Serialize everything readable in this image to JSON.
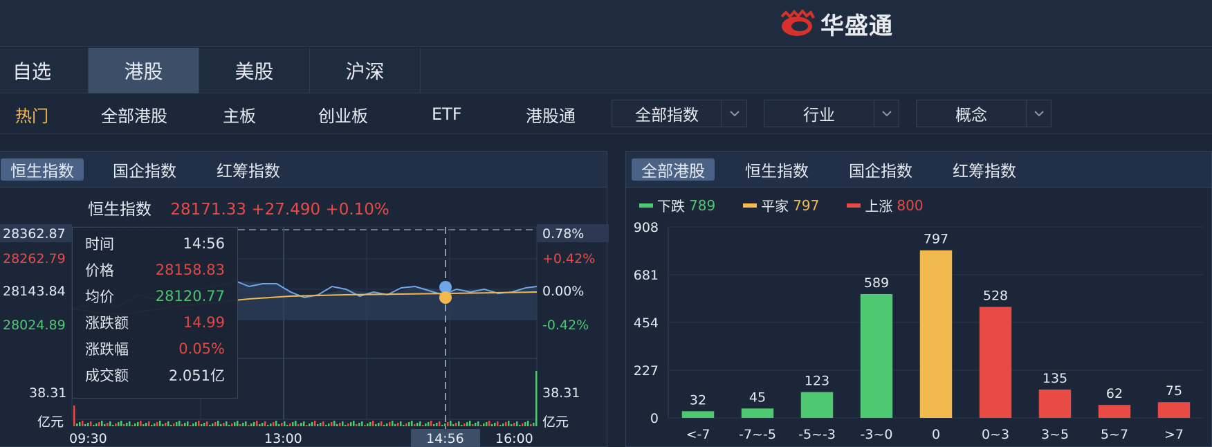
{
  "brand": {
    "name": "华盛通"
  },
  "market_tabs": [
    {
      "label": "自选"
    },
    {
      "label": "港股"
    },
    {
      "label": "美股"
    },
    {
      "label": "沪深"
    }
  ],
  "sub_nav": {
    "items": [
      {
        "label": "热门"
      },
      {
        "label": "全部港股"
      },
      {
        "label": "主板"
      },
      {
        "label": "创业板"
      },
      {
        "label": "ETF"
      },
      {
        "label": "港股通"
      }
    ],
    "dropdowns": [
      {
        "label": "全部指数"
      },
      {
        "label": "行业"
      },
      {
        "label": "概念"
      }
    ]
  },
  "left_panel": {
    "tabs": [
      {
        "label": "恒生指数"
      },
      {
        "label": "国企指数"
      },
      {
        "label": "红筹指数"
      }
    ],
    "quote": {
      "name": "恒生指数",
      "price": "28171.33",
      "change": "+27.490",
      "change_pct": "+0.10%"
    },
    "price_axis_left": [
      "28362.87",
      "28262.79",
      "28143.84",
      "28024.89"
    ],
    "price_axis_right": [
      "0.78%",
      "+0.42%",
      "0.00%",
      "-0.42%"
    ],
    "volume_axis": {
      "value": "38.31",
      "unit": "亿元"
    },
    "time_axis": [
      "09:30",
      "13:00",
      "16:00"
    ],
    "cursor_time": "14:56",
    "tooltip": {
      "rows": [
        {
          "key": "时间",
          "value": "14:56"
        },
        {
          "key": "价格",
          "value": "28158.83"
        },
        {
          "key": "均价",
          "value": "28120.77"
        },
        {
          "key": "涨跌额",
          "value": "14.99"
        },
        {
          "key": "涨跌幅",
          "value": "0.05%"
        },
        {
          "key": "成交额",
          "value": "2.051亿"
        }
      ]
    }
  },
  "right_panel": {
    "tabs": [
      {
        "label": "全部港股"
      },
      {
        "label": "恒生指数"
      },
      {
        "label": "国企指数"
      },
      {
        "label": "红筹指数"
      }
    ],
    "legend": [
      {
        "label": "下跌",
        "value": "789",
        "color": "#4ec972"
      },
      {
        "label": "平家",
        "value": "797",
        "color": "#f2b94f"
      },
      {
        "label": "上涨",
        "value": "800",
        "color": "#e84b45"
      }
    ]
  },
  "chart_data": {
    "type": "bar",
    "categories": [
      "<-7",
      "-7~-5",
      "-5~-3",
      "-3~0",
      "0",
      "0~3",
      "3~5",
      "5~7",
      ">7"
    ],
    "values": [
      32,
      45,
      123,
      589,
      797,
      528,
      135,
      62,
      75
    ],
    "colors": [
      "#4ec972",
      "#4ec972",
      "#4ec972",
      "#4ec972",
      "#f2b94f",
      "#e84b45",
      "#e84b45",
      "#e84b45",
      "#e84b45"
    ],
    "yticks": [
      0,
      227,
      454,
      681,
      908
    ],
    "ylim": [
      0,
      908
    ],
    "grid": true
  }
}
